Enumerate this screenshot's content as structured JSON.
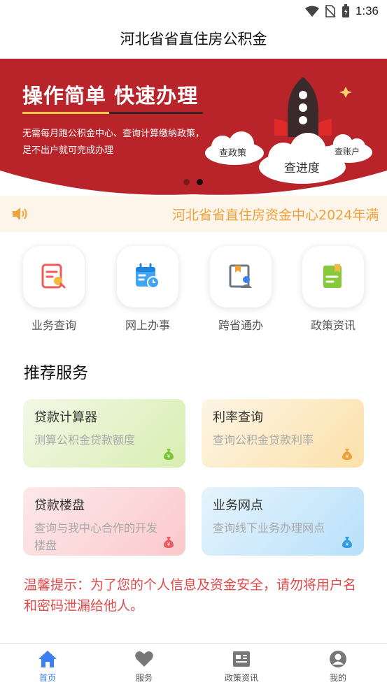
{
  "status_bar": {
    "time": "1:36"
  },
  "header": {
    "title": "河北省省直住房公积金"
  },
  "banner": {
    "headline": "操作简单 快速办理",
    "description": "无需每月跑公积金中心、查询计算缴纳政策，足不出户就可完成办理",
    "cloud_labels": [
      "查政策",
      "查进度",
      "查账户"
    ]
  },
  "notice": {
    "text": "河北省省直住房资金中心2024年满"
  },
  "quick_actions": [
    {
      "label": "业务查询",
      "icon": "document-search-icon"
    },
    {
      "label": "网上办事",
      "icon": "calendar-clock-icon"
    },
    {
      "label": "跨省通办",
      "icon": "book-person-icon"
    },
    {
      "label": "政策资讯",
      "icon": "bookmark-doc-icon"
    }
  ],
  "recommended": {
    "title": "推荐服务",
    "cards": [
      {
        "title": "贷款计算器",
        "subtitle": "测算公积金贷款额度",
        "color": "#7cc43c"
      },
      {
        "title": "利率查询",
        "subtitle": "查询公积金贷款利率",
        "color": "#f0a23c"
      },
      {
        "title": "贷款楼盘",
        "subtitle": "查询与我中心合作的开发楼盘",
        "color": "#e85a64"
      },
      {
        "title": "业务网点",
        "subtitle": "查询线下业务办理网点",
        "color": "#2d9be6"
      }
    ]
  },
  "tip": "温馨提示：为了您的个人信息及资金安全，请勿将用户名和密码泄漏给他人。",
  "bottom_nav": [
    {
      "label": "首页",
      "icon": "home-icon",
      "active": true
    },
    {
      "label": "服务",
      "icon": "heart-icon",
      "active": false
    },
    {
      "label": "政策资讯",
      "icon": "newspaper-icon",
      "active": false
    },
    {
      "label": "我的",
      "icon": "user-icon",
      "active": false
    }
  ],
  "colors": {
    "accent": "#3b7ff2",
    "banner_red": "#b8242a",
    "tip_red": "#e04a4a",
    "notice_orange": "#f0a23c"
  }
}
